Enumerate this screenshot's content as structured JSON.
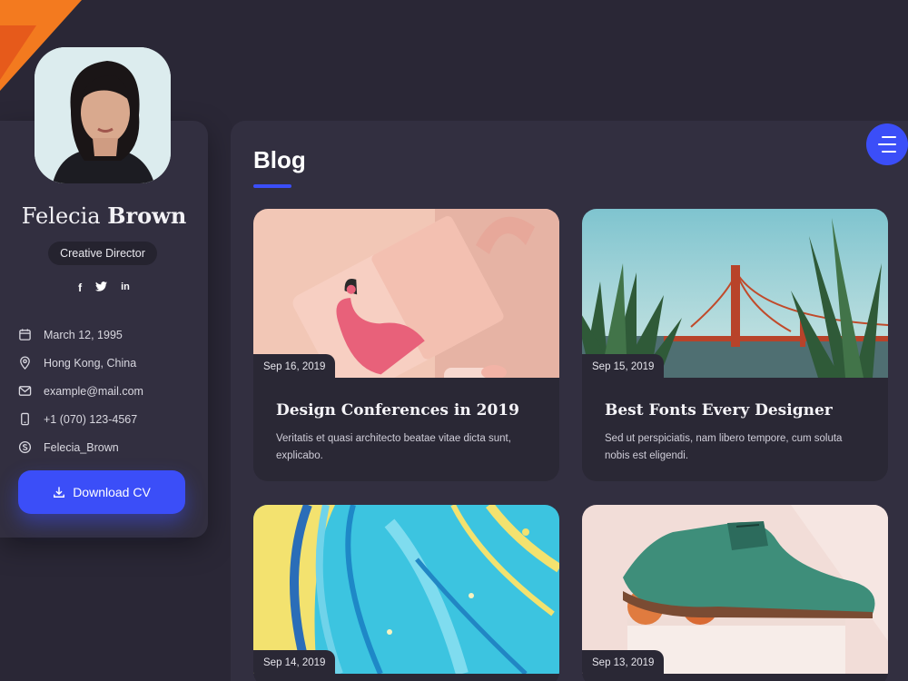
{
  "profile": {
    "first_name": "Felecia",
    "last_name": "Brown",
    "role": "Creative Director",
    "socials": [
      "f",
      "twitter",
      "in"
    ],
    "info": [
      {
        "icon": "calendar-icon",
        "text": "March 12, 1995"
      },
      {
        "icon": "location-icon",
        "text": "Hong Kong, China"
      },
      {
        "icon": "mail-icon",
        "text": "example@mail.com"
      },
      {
        "icon": "phone-icon",
        "text": "+1 (070) 123-4567"
      },
      {
        "icon": "skype-icon",
        "text": "Felecia_Brown"
      }
    ],
    "download_label": "Download CV"
  },
  "blog": {
    "title": "Blog",
    "posts": [
      {
        "date": "Sep 16, 2019",
        "title": "Design Conferences in 2019",
        "excerpt": "Veritatis et quasi architecto beatae vitae dicta sunt, explicabo."
      },
      {
        "date": "Sep 15, 2019",
        "title": "Best Fonts Every Designer",
        "excerpt": "Sed ut perspiciatis, nam libero tempore, cum soluta nobis est eligendi."
      },
      {
        "date": "Sep 14, 2019",
        "title": "",
        "excerpt": ""
      },
      {
        "date": "Sep 13, 2019",
        "title": "",
        "excerpt": ""
      }
    ]
  },
  "colors": {
    "accent": "#3b4ef8",
    "background": "#2a2736",
    "card": "#322f40",
    "corner": "#f37a1f"
  }
}
